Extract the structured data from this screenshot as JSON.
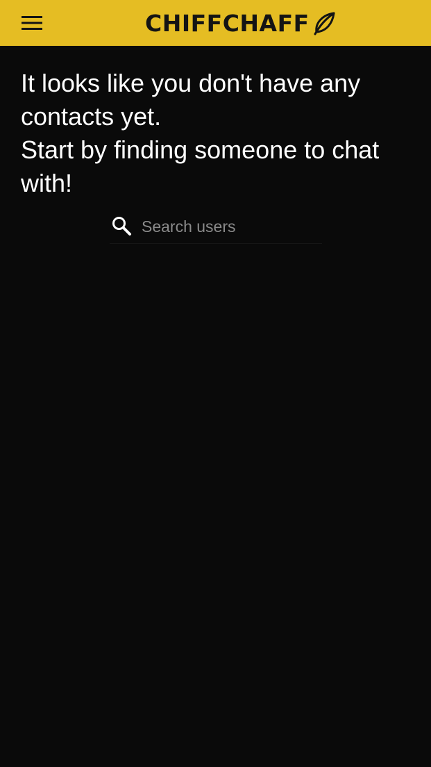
{
  "header": {
    "brand_name": "CHIFFCHAFF",
    "menu_icon": "hamburger-menu-icon",
    "logo_icon": "leaf-icon",
    "background_color": "#e5bd23",
    "brand_color": "#141414"
  },
  "main": {
    "message_line1": "It looks like you don't have any contacts yet.",
    "message_line2": "Start by finding someone to chat with!",
    "background_color": "#0a0a0a",
    "text_color": "#ffffff"
  },
  "search": {
    "placeholder": "Search users",
    "value": "",
    "icon": "search-icon"
  }
}
